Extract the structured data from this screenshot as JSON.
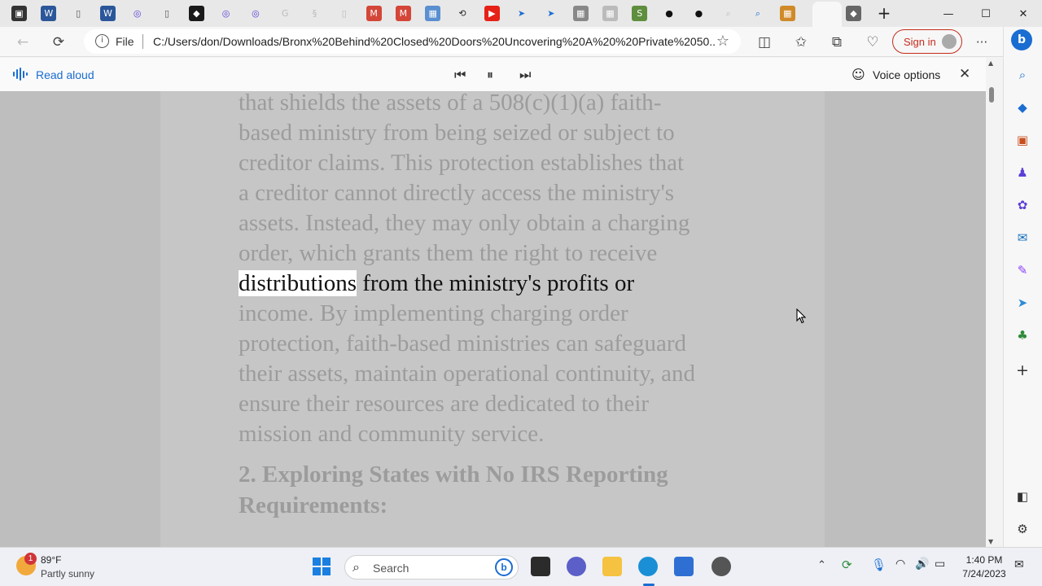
{
  "tabs": [
    {
      "icon": "tab-actions-icon",
      "color": "#333333"
    },
    {
      "icon": "word-icon",
      "color": "#2b579a"
    },
    {
      "icon": "document-icon",
      "color": "#555555"
    },
    {
      "icon": "word-icon",
      "color": "#2b579a"
    },
    {
      "icon": "copilot-icon",
      "color": "#5b3fd6"
    },
    {
      "icon": "document-icon",
      "color": "#555555"
    },
    {
      "icon": "app-icon",
      "color": "#1a1a1a"
    },
    {
      "icon": "copilot-icon",
      "color": "#5b3fd6"
    },
    {
      "icon": "copilot-icon",
      "color": "#5b3fd6"
    },
    {
      "icon": "google-icon",
      "color": "#bbbbbb"
    },
    {
      "icon": "law-icon",
      "color": "#bbbbbb"
    },
    {
      "icon": "document-icon",
      "color": "#bbbbbb"
    },
    {
      "icon": "gmail-icon",
      "color": "#d44638"
    },
    {
      "icon": "gmail-icon",
      "color": "#d44638"
    },
    {
      "icon": "image-icon",
      "color": "#5a8fd0"
    },
    {
      "icon": "sync-icon",
      "color": "#222222"
    },
    {
      "icon": "youtube-icon",
      "color": "#e62117"
    },
    {
      "icon": "arrow-icon",
      "color": "#1a6dd1"
    },
    {
      "icon": "arrow-icon",
      "color": "#1a6dd1"
    },
    {
      "icon": "image-icon",
      "color": "#888888"
    },
    {
      "icon": "image-icon",
      "color": "#bbbbbb"
    },
    {
      "icon": "shopify-icon",
      "color": "#5e8e3e"
    },
    {
      "icon": "circle-icon",
      "color": "#111111"
    },
    {
      "icon": "circle-icon",
      "color": "#111111"
    },
    {
      "icon": "search-icon",
      "color": "#bbbbbb"
    },
    {
      "icon": "search-icon",
      "color": "#1a6dd1"
    },
    {
      "icon": "image-icon",
      "color": "#d08a2a"
    },
    {
      "icon": "bolt-icon",
      "color": "#f0a30a"
    },
    {
      "icon": "close-icon",
      "color": "#333333"
    },
    {
      "icon": "app-icon",
      "color": "#666666"
    }
  ],
  "window": {
    "minimize": "—",
    "maximize": "☐",
    "close": "✕",
    "new_tab": "+"
  },
  "address": {
    "scheme": "File",
    "url": "C:/Users/don/Downloads/Bronx%20Behind%20Closed%20Doors%20Uncovering%20A%20%20Private%2050..."
  },
  "signin": {
    "label": "Sign in"
  },
  "read_aloud": {
    "label": "Read aloud",
    "voice_options": "Voice options"
  },
  "article": {
    "lines_before": [
      "that shields the assets of a 508(c)(1)(a) faith-",
      "based ministry from being seized or subject to",
      "creditor claims. This protection establishes that",
      "a creditor cannot directly access the ministry's",
      "assets. Instead, they may only obtain a charging",
      "order, which grants them the right to receive"
    ],
    "highlight_word": "distributions",
    "highlight_rest": " from the ministry's profits or",
    "lines_after": [
      "income. By implementing charging order",
      "protection, faith-based ministries can safeguard",
      "their assets, maintain operational continuity, and",
      "ensure their resources are dedicated to their",
      "mission and community service."
    ],
    "heading_lines": [
      "2. Exploring States with No IRS Reporting",
      "Requirements:"
    ]
  },
  "weather": {
    "temp": "89°F",
    "condition": "Partly sunny",
    "badge": "1"
  },
  "taskbar": {
    "search_label": "Search"
  },
  "clock": {
    "time": "1:40 PM",
    "date": "7/24/2023"
  }
}
